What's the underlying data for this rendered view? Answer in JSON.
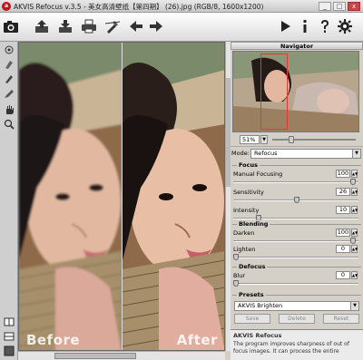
{
  "titlebar": {
    "title": "AKVIS Refocus v.3.5 - 美女高清壁纸【第四期】 (26).jpg (RGB/8, 1600x1200)",
    "minimize": "_",
    "maximize": "□",
    "close": "x"
  },
  "toolbar": {
    "icons": [
      "camera-icon",
      "open-icon",
      "save-icon",
      "print-icon",
      "tool-icon",
      "back-arrow-icon",
      "forward-arrow-icon",
      "run-icon",
      "info-icon",
      "help-icon",
      "settings-icon"
    ]
  },
  "left_tools": [
    "refocus-brush-icon",
    "eraser-icon",
    "pen-icon",
    "pencil-icon",
    "hand-icon",
    "zoom-icon",
    "split-view-icon",
    "single-view-icon",
    "color-icon"
  ],
  "canvas": {
    "before_label": "Before",
    "after_label": "After"
  },
  "navigator": {
    "title": "Navigator",
    "zoom": "51%"
  },
  "mode": {
    "label": "Mode:",
    "value": "Refocus"
  },
  "focus": {
    "title": "Focus",
    "params": [
      {
        "label": "Manual Focusing",
        "value": "100",
        "fraction": 0.98
      },
      {
        "label": "Sensitivity",
        "value": "26",
        "fraction": 0.51
      },
      {
        "label": "Intensity",
        "value": "10",
        "fraction": 0.19
      }
    ]
  },
  "blending": {
    "title": "Blending",
    "params": [
      {
        "label": "Darken",
        "value": "100",
        "fraction": 0.98
      },
      {
        "label": "Lighten",
        "value": "0",
        "fraction": 0.0
      }
    ]
  },
  "defocus": {
    "title": "Defocus",
    "params": [
      {
        "label": "Blur",
        "value": "0",
        "fraction": 0.0
      }
    ]
  },
  "presets": {
    "title": "Presets",
    "value": "AKVIS Brighten",
    "save": "Save",
    "delete": "Delete",
    "reset": "Reset"
  },
  "help": {
    "title": "AKVIS Refocus",
    "text1": "The program improves sharpness of out of",
    "text2": "focus images. It can process the entire"
  },
  "colors": {
    "accent": "#c0151a",
    "panel": "#d4d0c8",
    "nav_rect": "#ee3333"
  }
}
